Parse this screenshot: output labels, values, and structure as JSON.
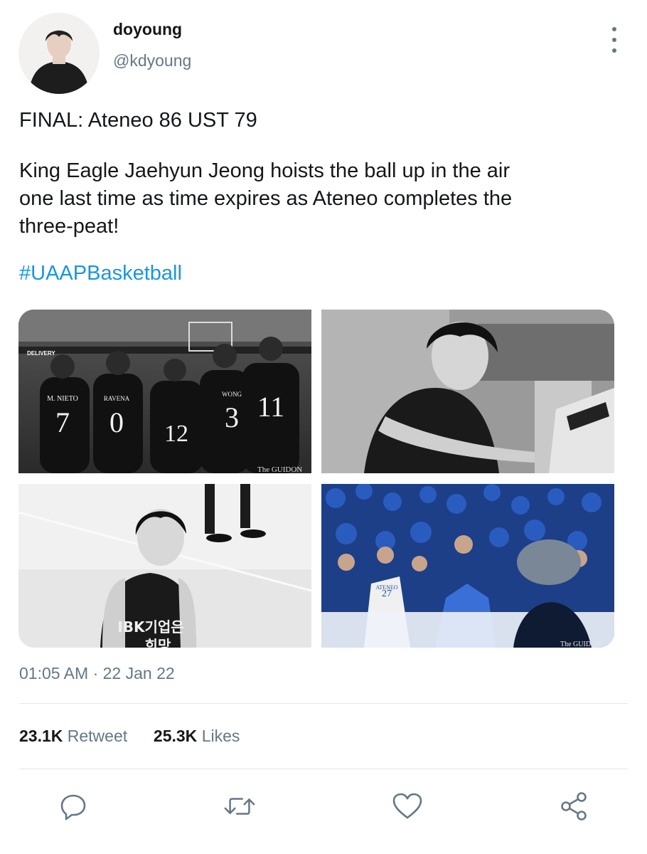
{
  "tweet": {
    "display_name": "doyoung",
    "handle": "@kdyoung",
    "text_lines": [
      "FINAL: Ateneo 86 UST 79",
      "King Eagle Jaehyun Jeong hoists the ball up in the air",
      "one last time as time expires as Ateneo completes the",
      "three-peat!"
    ],
    "hashtag": "#UAAPBasketball",
    "timestamp": "01:05 AM · 22 Jan 22"
  },
  "media": {
    "photo1": {
      "banner": "DELIVERY",
      "jerseys": [
        {
          "name": "M. NIETO",
          "number": "7"
        },
        {
          "name": "RAVENA",
          "number": "0"
        },
        {
          "name": "",
          "number": "12"
        },
        {
          "name": "WONG",
          "number": "3"
        },
        {
          "name": "",
          "number": "11"
        }
      ],
      "watermark": "The GUIDON"
    },
    "photo3": {
      "jersey_text": "IBK기업은",
      "jersey_text2": "희망"
    },
    "photo4": {
      "jersey_number": "27",
      "jersey_team": "ATENEO",
      "watermark": "The GUIDON"
    }
  },
  "stats": {
    "retweets_count": "23.1K",
    "retweets_label": "Retweet",
    "likes_count": "25.3K",
    "likes_label": "Likes"
  },
  "actions": {
    "icons": [
      "reply-icon",
      "retweet-icon",
      "like-icon",
      "share-icon"
    ]
  },
  "colors": {
    "link": "#1b95e0",
    "secondary_text": "#657786",
    "primary_text": "#14171a",
    "divider": "#e1e8ed",
    "crowd_blue": "#1f4fa8"
  }
}
